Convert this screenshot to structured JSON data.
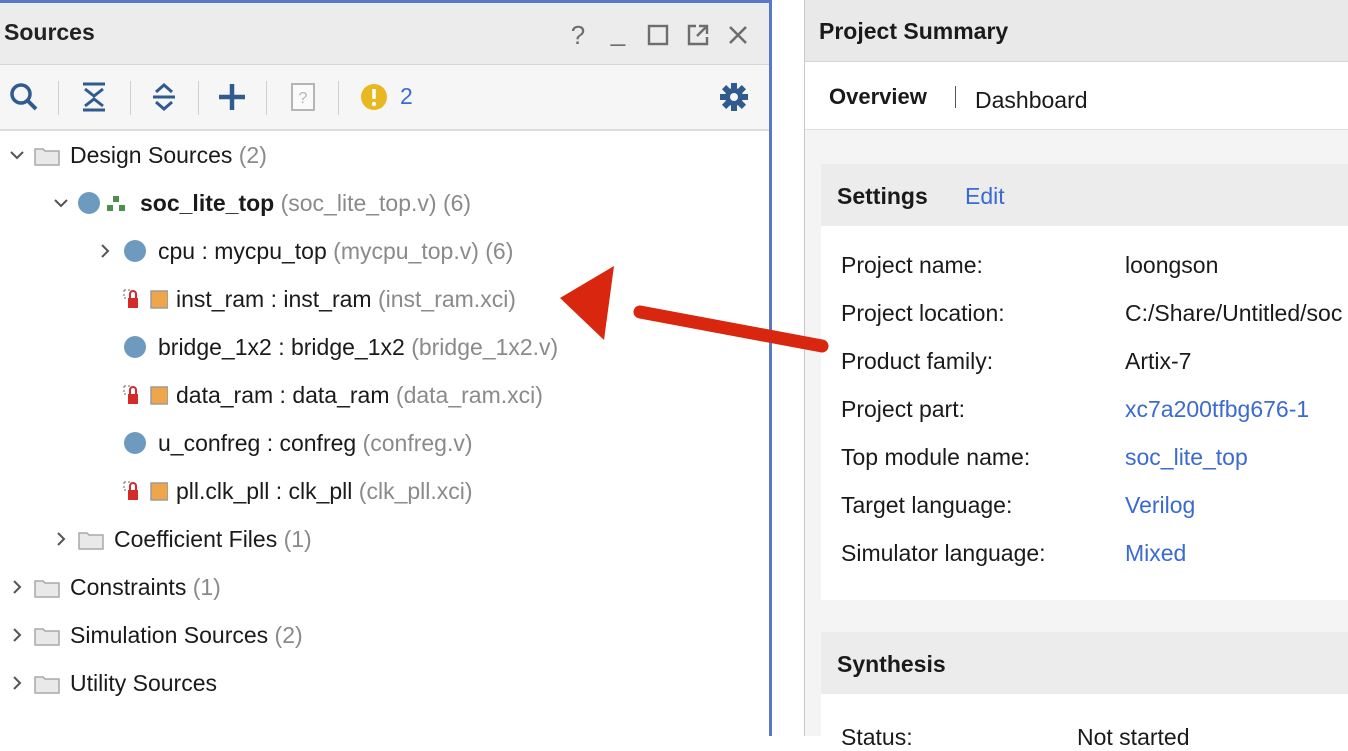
{
  "sources_panel": {
    "title": "Sources",
    "window_controls": [
      "?",
      "_",
      "□",
      "↗",
      "✕"
    ],
    "toolbar": {
      "icons": [
        "search-icon",
        "collapse-all-icon",
        "expand-all-icon",
        "add-icon",
        "help-icon",
        "warning-icon",
        "settings-icon"
      ],
      "warning_count": "2"
    },
    "tree": {
      "design_sources": {
        "label": "Design Sources",
        "count": "(2)"
      },
      "top": {
        "label": "soc_lite_top",
        "file": "(soc_lite_top.v)",
        "count": "(6)"
      },
      "children": [
        {
          "label": "cpu : mycpu_top",
          "file": "(mycpu_top.v)",
          "count": "(6)"
        },
        {
          "label": "inst_ram : inst_ram",
          "file": "(inst_ram.xci)"
        },
        {
          "label": "bridge_1x2 : bridge_1x2",
          "file": "(bridge_1x2.v)"
        },
        {
          "label": "data_ram : data_ram",
          "file": "(data_ram.xci)"
        },
        {
          "label": "u_confreg : confreg",
          "file": "(confreg.v)"
        },
        {
          "label": "pll.clk_pll : clk_pll",
          "file": "(clk_pll.xci)"
        }
      ],
      "coefficient": {
        "label": "Coefficient Files",
        "count": "(1)"
      },
      "constraints": {
        "label": "Constraints",
        "count": "(1)"
      },
      "simulation": {
        "label": "Simulation Sources",
        "count": "(2)"
      },
      "utility": {
        "label": "Utility Sources"
      }
    }
  },
  "summary_panel": {
    "title": "Project Summary",
    "tabs": [
      "Overview",
      "Dashboard"
    ],
    "settings": {
      "title": "Settings",
      "edit_label": "Edit",
      "rows": [
        {
          "key": "Project name:",
          "value": "loongson"
        },
        {
          "key": "Project location:",
          "value": "C:/Share/Untitled/soc"
        },
        {
          "key": "Product family:",
          "value": "Artix-7"
        },
        {
          "key": "Project part:",
          "value": "xc7a200tfbg676-1"
        },
        {
          "key": "Top module name:",
          "value": "soc_lite_top"
        },
        {
          "key": "Target language:",
          "value": "Verilog"
        },
        {
          "key": "Simulator language:",
          "value": "Mixed"
        }
      ]
    },
    "synthesis": {
      "title": "Synthesis",
      "status_key": "Status:",
      "status_value": "Not started"
    }
  },
  "colors": {
    "panel_border": "#5a78c8",
    "link": "#3b6ad1",
    "arrow": "#d9260f",
    "module_dot": "#6d9bbf",
    "warning": "#e8b820"
  }
}
